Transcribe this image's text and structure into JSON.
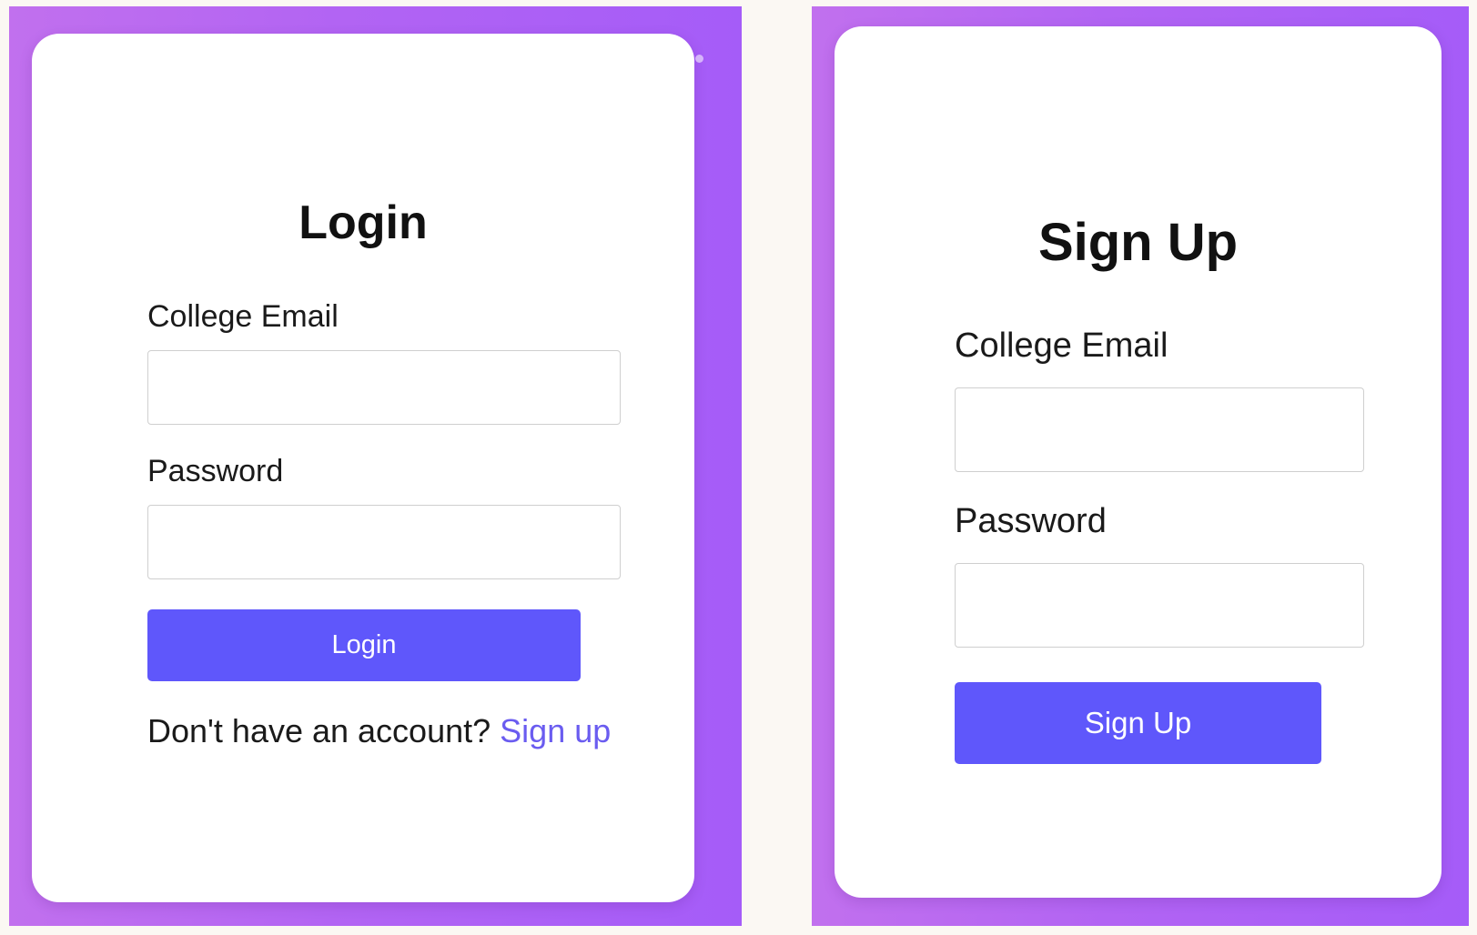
{
  "login_card": {
    "title": "Login",
    "email_label": "College Email",
    "email_value": "",
    "password_label": "Password",
    "password_value": "",
    "submit_label": "Login",
    "footer_prompt": "Don't have an account?",
    "footer_link": "Sign up"
  },
  "signup_card": {
    "title": "Sign Up",
    "email_label": "College Email",
    "email_value": "",
    "password_label": "Password",
    "password_value": "",
    "submit_label": "Sign Up"
  },
  "colors": {
    "background": "#fbf8f3",
    "panel_gradient_start": "#c170ee",
    "panel_gradient_end": "#a55cf8",
    "card": "#ffffff",
    "button": "#5f57fb",
    "link": "#6a5cf0",
    "text": "#1a1a1a"
  }
}
